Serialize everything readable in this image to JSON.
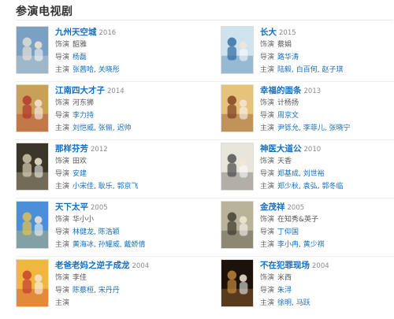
{
  "section": {
    "title": "参演电视剧"
  },
  "labels": {
    "role": "饰演",
    "director": "导演",
    "cast": "主演"
  },
  "colors": {
    "link": "#136ec2",
    "text": "#333333",
    "muted": "#888888"
  },
  "dramas": [
    {
      "title": "九州天空城",
      "year": "2016",
      "role": "韶雅",
      "director": "杨磊",
      "cast": "张茜哈, 关晓彤"
    },
    {
      "title": "长大",
      "year": "2015",
      "role": "蔡娟",
      "director": "路华涛",
      "cast": "陆毅, 白百何, 赵子琪"
    },
    {
      "title": "江南四大才子",
      "year": "2014",
      "role": "河东狮",
      "director": "李力持",
      "cast": "刘恺威, 张俪, 迟帅"
    },
    {
      "title": "幸福的面条",
      "year": "2013",
      "role": "计杨扬",
      "director": "周京文",
      "cast": "尹铄允, 李菲儿, 张晓宁"
    },
    {
      "title": "那样芬芳",
      "year": "2012",
      "role": "田欢",
      "director": "安建",
      "cast": "小宋佳, 耿乐, 郭京飞"
    },
    {
      "title": "神医大道公",
      "year": "2010",
      "role": "天香",
      "director": "郑基成, 刘世裕",
      "cast": "郑少秋, 袁弘, 郭冬临"
    },
    {
      "title": "天下太平",
      "year": "2005",
      "role": "华小小",
      "director": "林健龙, 陈浩颖",
      "cast": "黄海冰, 孙耀威, 戴娇倩"
    },
    {
      "title": "金茂祥",
      "year": "2005",
      "role": "在知秀&英子",
      "director": "丁仰国",
      "cast": "李小冉, 黄少祺"
    },
    {
      "title": "老爸老妈之逆子成龙",
      "year": "2004",
      "role": "李佳",
      "director": "陈蔡桓, 宋丹丹",
      "cast": ""
    },
    {
      "title": "不在犯罪现场",
      "year": "2004",
      "role": "米西",
      "director": "朱浔",
      "cast": "徐明, 马跃"
    }
  ],
  "posters": [
    {
      "icon": "poster-jiuzhou-icon",
      "bg": "#7aa0c4",
      "accent": "#e6e2d8"
    },
    {
      "icon": "poster-zhangda-icon",
      "bg": "#cfe3ef",
      "accent": "#2c6aa3"
    },
    {
      "icon": "poster-jiangnan-icon",
      "bg": "#c9a05a",
      "accent": "#b2322a"
    },
    {
      "icon": "poster-xingfu-icon",
      "bg": "#e7c27a",
      "accent": "#7a3d1f"
    },
    {
      "icon": "poster-nayang-icon",
      "bg": "#3b3628",
      "accent": "#d9cfb2"
    },
    {
      "icon": "poster-shenyi-icon",
      "bg": "#e8e5da",
      "accent": "#4a4a4a"
    },
    {
      "icon": "poster-tianxia-icon",
      "bg": "#4d8fd6",
      "accent": "#e8c34a"
    },
    {
      "icon": "poster-jinmao-icon",
      "bg": "#b9b39a",
      "accent": "#3d3a2d"
    },
    {
      "icon": "poster-laoba-icon",
      "bg": "#f0b640",
      "accent": "#c63c2c"
    },
    {
      "icon": "poster-bufan-icon",
      "bg": "#1b120c",
      "accent": "#c88a3c"
    }
  ]
}
